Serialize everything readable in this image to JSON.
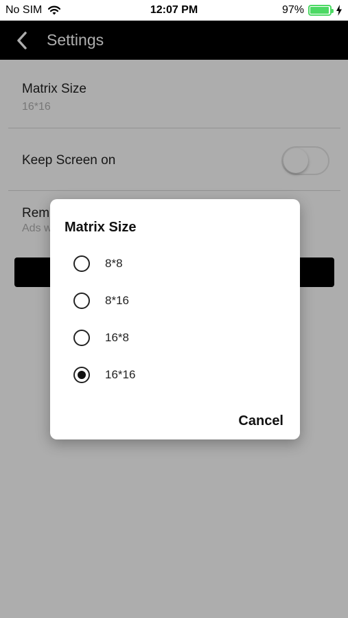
{
  "status_bar": {
    "carrier": "No SIM",
    "time": "12:07 PM",
    "battery": "97%"
  },
  "nav": {
    "title": "Settings",
    "back_icon": "chevron-left-icon"
  },
  "settings": {
    "matrix": {
      "label": "Matrix Size",
      "value": "16*16"
    },
    "keep_screen": {
      "label": "Keep Screen on",
      "enabled": false
    },
    "remove_ads": {
      "label": "Rem",
      "subtitle": "Ads w"
    }
  },
  "dialog": {
    "title": "Matrix Size",
    "options": [
      {
        "label": "8*8",
        "selected": false
      },
      {
        "label": "8*16",
        "selected": false
      },
      {
        "label": "16*8",
        "selected": false
      },
      {
        "label": "16*16",
        "selected": true
      }
    ],
    "cancel_label": "Cancel"
  },
  "colors": {
    "battery": "#4cd964",
    "nav_background": "#000000",
    "overlay": "rgba(0,0,0,0.32)"
  }
}
